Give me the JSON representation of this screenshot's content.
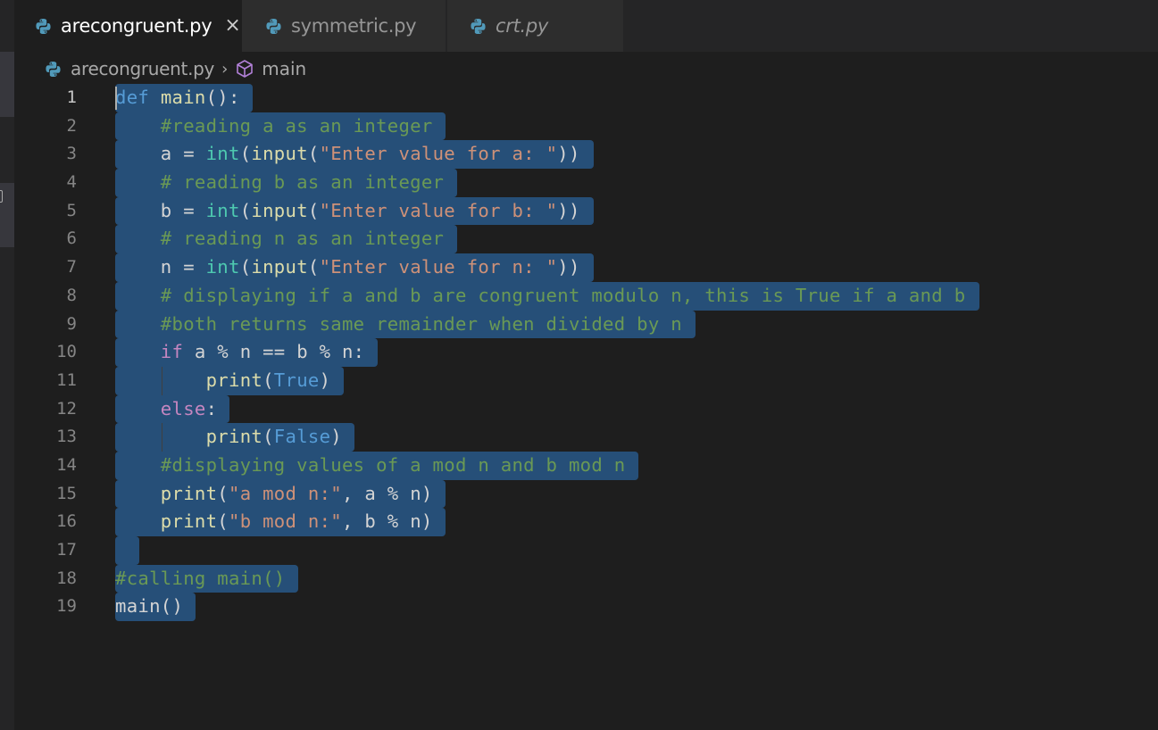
{
  "tabs": [
    {
      "label": "arecongruent.py",
      "active": true,
      "icon": "python-icon",
      "close": "×"
    },
    {
      "label": "symmetric.py",
      "active": false,
      "icon": "python-icon"
    },
    {
      "label": "crt.py",
      "active": false,
      "preview": true,
      "icon": "python-icon"
    }
  ],
  "breadcrumb": {
    "file": "arecongruent.py",
    "separator": "›",
    "symbol": "main",
    "symbol_icon": "cube-icon"
  },
  "editor": {
    "language": "python",
    "selection_color": "#264f78",
    "current_line": 1,
    "lines": [
      {
        "n": "1",
        "tokens": [
          [
            "kw",
            "def"
          ],
          [
            "plain",
            " "
          ],
          [
            "fn",
            "main"
          ],
          [
            "plain",
            "():"
          ]
        ]
      },
      {
        "n": "2",
        "tokens": [
          [
            "plain",
            "    "
          ],
          [
            "cmt",
            "#reading a as an integer"
          ]
        ]
      },
      {
        "n": "3",
        "tokens": [
          [
            "plain",
            "    a = "
          ],
          [
            "cls",
            "int"
          ],
          [
            "plain",
            "("
          ],
          [
            "fn",
            "input"
          ],
          [
            "plain",
            "("
          ],
          [
            "str",
            "\"Enter value for a: \""
          ],
          [
            "plain",
            "))"
          ]
        ]
      },
      {
        "n": "4",
        "tokens": [
          [
            "plain",
            "    "
          ],
          [
            "cmt",
            "# reading b as an integer"
          ]
        ]
      },
      {
        "n": "5",
        "tokens": [
          [
            "plain",
            "    b = "
          ],
          [
            "cls",
            "int"
          ],
          [
            "plain",
            "("
          ],
          [
            "fn",
            "input"
          ],
          [
            "plain",
            "("
          ],
          [
            "str",
            "\"Enter value for b: \""
          ],
          [
            "plain",
            "))"
          ]
        ]
      },
      {
        "n": "6",
        "tokens": [
          [
            "plain",
            "    "
          ],
          [
            "cmt",
            "# reading n as an integer"
          ]
        ]
      },
      {
        "n": "7",
        "tokens": [
          [
            "plain",
            "    n = "
          ],
          [
            "cls",
            "int"
          ],
          [
            "plain",
            "("
          ],
          [
            "fn",
            "input"
          ],
          [
            "plain",
            "("
          ],
          [
            "str",
            "\"Enter value for n: \""
          ],
          [
            "plain",
            "))"
          ]
        ]
      },
      {
        "n": "8",
        "tokens": [
          [
            "plain",
            "    "
          ],
          [
            "cmt",
            "# displaying if a and b are congruent modulo n, this is True if a and b"
          ]
        ]
      },
      {
        "n": "9",
        "tokens": [
          [
            "plain",
            "    "
          ],
          [
            "cmt",
            "#both returns same remainder when divided by n"
          ]
        ]
      },
      {
        "n": "10",
        "tokens": [
          [
            "plain",
            "    "
          ],
          [
            "ctl",
            "if"
          ],
          [
            "plain",
            " a % n == b % n:"
          ]
        ]
      },
      {
        "n": "11",
        "tokens": [
          [
            "plain",
            "        "
          ],
          [
            "fn",
            "print"
          ],
          [
            "plain",
            "("
          ],
          [
            "kw",
            "True"
          ],
          [
            "plain",
            ")"
          ]
        ]
      },
      {
        "n": "12",
        "tokens": [
          [
            "plain",
            "    "
          ],
          [
            "ctl",
            "else"
          ],
          [
            "plain",
            ":"
          ]
        ]
      },
      {
        "n": "13",
        "tokens": [
          [
            "plain",
            "        "
          ],
          [
            "fn",
            "print"
          ],
          [
            "plain",
            "("
          ],
          [
            "kw",
            "False"
          ],
          [
            "plain",
            ")"
          ]
        ]
      },
      {
        "n": "14",
        "tokens": [
          [
            "plain",
            "    "
          ],
          [
            "cmt",
            "#displaying values of a mod n and b mod n"
          ]
        ]
      },
      {
        "n": "15",
        "tokens": [
          [
            "plain",
            "    "
          ],
          [
            "fn",
            "print"
          ],
          [
            "plain",
            "("
          ],
          [
            "str",
            "\"a mod n:\""
          ],
          [
            "plain",
            ", a % n)"
          ]
        ]
      },
      {
        "n": "16",
        "tokens": [
          [
            "plain",
            "    "
          ],
          [
            "fn",
            "print"
          ],
          [
            "plain",
            "("
          ],
          [
            "str",
            "\"b mod n:\""
          ],
          [
            "plain",
            ", b % n)"
          ]
        ]
      },
      {
        "n": "17",
        "tokens": [
          [
            "plain",
            " "
          ]
        ]
      },
      {
        "n": "18",
        "tokens": [
          [
            "cmt",
            "#calling main()"
          ]
        ]
      },
      {
        "n": "19",
        "tokens": [
          [
            "plain",
            "main()"
          ]
        ]
      }
    ]
  }
}
